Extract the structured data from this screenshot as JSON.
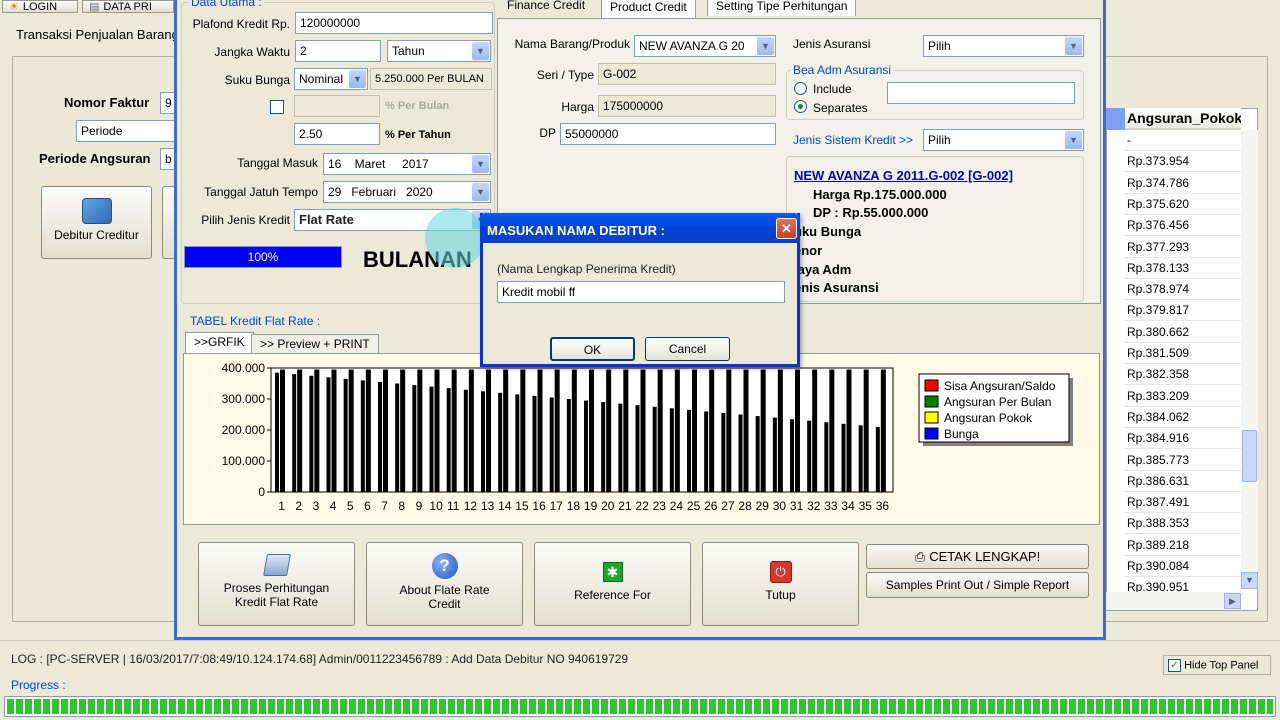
{
  "toolbar": {
    "login": "LOGIN",
    "data_print": "DATA PRI"
  },
  "app": {
    "subtitle": "Transaksi Penjualan Barang"
  },
  "left": {
    "nomor_faktur_label": "Nomor Faktur",
    "nomor_faktur_value": "9",
    "periode_value": "Periode",
    "periode_angsuran_label": "Periode Angsuran",
    "periode_angsuran_value": "b",
    "debitur_button": "Debitur Creditur"
  },
  "data_utama": {
    "title": "Data Utama :",
    "plafond_label": "Plafond Kredit Rp.",
    "plafond_value": "120000000",
    "jangka_label": "Jangka Waktu",
    "jangka_value": "2",
    "jangka_unit": "Tahun",
    "suku_label": "Suku Bunga",
    "suku_type": "Nominal",
    "suku_nominal": "5.250.000 Per BULAN",
    "per_bulan_label": "% Per Bulan",
    "rate_value": "2.50",
    "per_tahun_label": "% Per Tahun",
    "tgl_masuk_label": "Tanggal Masuk",
    "tgl_masuk_value": "16    Maret     2017",
    "tgl_jatuh_label": "Tanggal Jatuh Tempo",
    "tgl_jatuh_value": "29   Februari   2020",
    "jenis_label": "Pilih Jenis Kredit",
    "jenis_value": "Flat Rate",
    "progress_text": "100%",
    "progress_value": 1.0,
    "bulanan_label": "BULANAN"
  },
  "tabs": {
    "finance": "Finance Credit",
    "product": "Product Credit",
    "setting": "Setting Tipe Perhitungan"
  },
  "product": {
    "nama_label": "Nama Barang/Produk",
    "nama_value": "NEW AVANZA G 20",
    "seri_label": "Seri / Type",
    "seri_value": "G-002",
    "harga_label": "Harga",
    "harga_value": "175000000",
    "dp_label": "DP",
    "dp_value": "55000000",
    "jenis_asuransi_label": "Jenis Asuransi",
    "jenis_asuransi_value": "Pilih",
    "bea_title": "Bea Adm Asuransi",
    "include_label": "Include",
    "separates_label": "Separates",
    "jenis_sistem_label": "Jenis Sistem Kredit >>",
    "jenis_sistem_value": "Pilih",
    "summary_link": "NEW AVANZA G 2011.G-002 [G-002]",
    "summary_harga": "Harga Rp.175.000.000",
    "summary_dp": "DP : Rp.55.000.000",
    "summary_suku": "uku Bunga",
    "summary_tenor": "enor",
    "summary_biaya": "iaya Adm",
    "summary_asuransi": "enis Asuransi"
  },
  "tabel": {
    "title": "TABEL Kredit Flat Rate :",
    "tab_grafik": ">>GRFIK",
    "tab_preview": ">> Preview + PRINT"
  },
  "chart_data": {
    "type": "bar",
    "categories": [
      "1",
      "2",
      "3",
      "4",
      "5",
      "6",
      "7",
      "8",
      "9",
      "10",
      "11",
      "12",
      "13",
      "14",
      "15",
      "16",
      "17",
      "18",
      "19",
      "20",
      "21",
      "22",
      "23",
      "24",
      "25",
      "26",
      "27",
      "28",
      "29",
      "30",
      "31",
      "32",
      "33",
      "34",
      "35",
      "36"
    ],
    "series": [
      {
        "name": "Sisa Angsuran/Saldo",
        "color": "#ff0000",
        "values": [
          385000,
          380000,
          375000,
          370000,
          365000,
          360000,
          355000,
          350000,
          345000,
          340000,
          335000,
          330000,
          325000,
          320000,
          315000,
          310000,
          305000,
          300000,
          295000,
          290000,
          285000,
          280000,
          275000,
          270000,
          265000,
          260000,
          255000,
          250000,
          245000,
          240000,
          235000,
          230000,
          225000,
          220000,
          215000,
          210000
        ]
      },
      {
        "name": "Angsuran Per Bulan",
        "color": "#008000",
        "values": [
          395000,
          395000,
          395000,
          395000,
          395000,
          395000,
          395000,
          395000,
          395000,
          395000,
          395000,
          395000,
          395000,
          395000,
          395000,
          395000,
          395000,
          395000,
          395000,
          395000,
          395000,
          395000,
          395000,
          395000,
          395000,
          395000,
          395000,
          395000,
          395000,
          395000,
          395000,
          395000,
          395000,
          395000,
          395000,
          395000
        ]
      },
      {
        "name": "Angsuran Pokok",
        "color": "#ffff00",
        "values": [
          0,
          0,
          0,
          0,
          0,
          0,
          0,
          0,
          0,
          0,
          0,
          0,
          0,
          0,
          0,
          0,
          0,
          0,
          0,
          0,
          0,
          0,
          0,
          0,
          0,
          0,
          0,
          0,
          0,
          0,
          0,
          0,
          0,
          0,
          0,
          0
        ]
      },
      {
        "name": "Bunga",
        "color": "#0000ff",
        "values": [
          0,
          0,
          0,
          0,
          0,
          0,
          0,
          0,
          0,
          0,
          0,
          0,
          0,
          0,
          0,
          0,
          0,
          0,
          0,
          0,
          0,
          0,
          0,
          0,
          0,
          0,
          0,
          0,
          0,
          0,
          0,
          0,
          0,
          0,
          0,
          0
        ]
      }
    ],
    "y_ticks": [
      "400.000",
      "300.000",
      "200.000",
      "100.000",
      "0"
    ],
    "ylim": [
      0,
      400000
    ],
    "legend_position": "top-right"
  },
  "buttons": {
    "proses": "Proses Perhitungan Kredit Flat Rate",
    "about": "About Flate Rate Credit",
    "reference": "Reference For",
    "tutup": "Tutup",
    "cetak": "CETAK LENGKAP!",
    "samples": "Samples Print Out / Simple Report"
  },
  "grid": {
    "header": "Angsuran_Pokok",
    "rows": [
      "-",
      "Rp.373.954",
      "Rp.374.786",
      "Rp.375.620",
      "Rp.376.456",
      "Rp.377.293",
      "Rp.378.133",
      "Rp.378.974",
      "Rp.379.817",
      "Rp.380.662",
      "Rp.381.509",
      "Rp.382.358",
      "Rp.383.209",
      "Rp.384.062",
      "Rp.384.916",
      "Rp.385.773",
      "Rp.386.631",
      "Rp.387.491",
      "Rp.388.353",
      "Rp.389.218",
      "Rp.390.084",
      "Rp.390.951"
    ]
  },
  "dialog": {
    "title": "MASUKAN NAMA DEBITUR :",
    "prompt": "(Nama Lengkap Penerima Kredit)",
    "value": "Kredit mobil ff",
    "ok": "OK",
    "cancel": "Cancel"
  },
  "status": {
    "log": "LOG : [PC-SERVER | 16/03/2017/7:08:49/10.124.174.68] Admin/0011223456789 : Add Data Debitur NO 940619729",
    "hide_top": "Hide Top Panel",
    "progress_label": "Progress :"
  }
}
